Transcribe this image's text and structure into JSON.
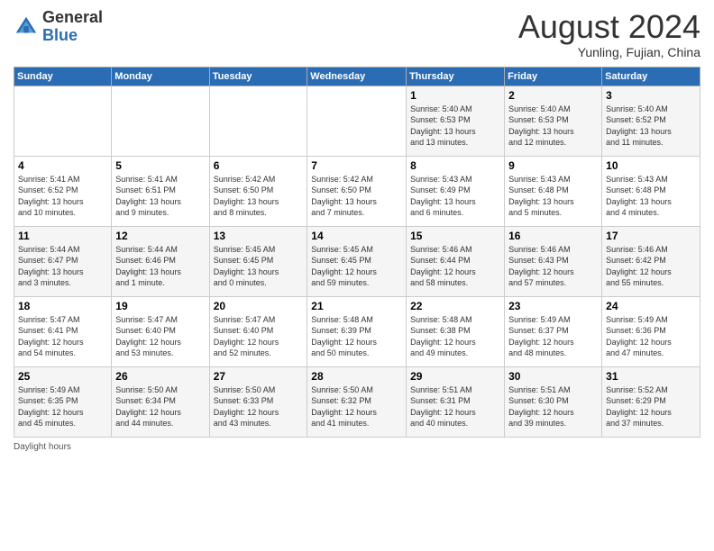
{
  "header": {
    "logo_general": "General",
    "logo_blue": "Blue",
    "month_title": "August 2024",
    "subtitle": "Yunling, Fujian, China"
  },
  "weekdays": [
    "Sunday",
    "Monday",
    "Tuesday",
    "Wednesday",
    "Thursday",
    "Friday",
    "Saturday"
  ],
  "footer": {
    "daylight_label": "Daylight hours"
  },
  "weeks": [
    [
      {
        "day": "",
        "info": ""
      },
      {
        "day": "",
        "info": ""
      },
      {
        "day": "",
        "info": ""
      },
      {
        "day": "",
        "info": ""
      },
      {
        "day": "1",
        "info": "Sunrise: 5:40 AM\nSunset: 6:53 PM\nDaylight: 13 hours\nand 13 minutes."
      },
      {
        "day": "2",
        "info": "Sunrise: 5:40 AM\nSunset: 6:53 PM\nDaylight: 13 hours\nand 12 minutes."
      },
      {
        "day": "3",
        "info": "Sunrise: 5:40 AM\nSunset: 6:52 PM\nDaylight: 13 hours\nand 11 minutes."
      }
    ],
    [
      {
        "day": "4",
        "info": "Sunrise: 5:41 AM\nSunset: 6:52 PM\nDaylight: 13 hours\nand 10 minutes."
      },
      {
        "day": "5",
        "info": "Sunrise: 5:41 AM\nSunset: 6:51 PM\nDaylight: 13 hours\nand 9 minutes."
      },
      {
        "day": "6",
        "info": "Sunrise: 5:42 AM\nSunset: 6:50 PM\nDaylight: 13 hours\nand 8 minutes."
      },
      {
        "day": "7",
        "info": "Sunrise: 5:42 AM\nSunset: 6:50 PM\nDaylight: 13 hours\nand 7 minutes."
      },
      {
        "day": "8",
        "info": "Sunrise: 5:43 AM\nSunset: 6:49 PM\nDaylight: 13 hours\nand 6 minutes."
      },
      {
        "day": "9",
        "info": "Sunrise: 5:43 AM\nSunset: 6:48 PM\nDaylight: 13 hours\nand 5 minutes."
      },
      {
        "day": "10",
        "info": "Sunrise: 5:43 AM\nSunset: 6:48 PM\nDaylight: 13 hours\nand 4 minutes."
      }
    ],
    [
      {
        "day": "11",
        "info": "Sunrise: 5:44 AM\nSunset: 6:47 PM\nDaylight: 13 hours\nand 3 minutes."
      },
      {
        "day": "12",
        "info": "Sunrise: 5:44 AM\nSunset: 6:46 PM\nDaylight: 13 hours\nand 1 minute."
      },
      {
        "day": "13",
        "info": "Sunrise: 5:45 AM\nSunset: 6:45 PM\nDaylight: 13 hours\nand 0 minutes."
      },
      {
        "day": "14",
        "info": "Sunrise: 5:45 AM\nSunset: 6:45 PM\nDaylight: 12 hours\nand 59 minutes."
      },
      {
        "day": "15",
        "info": "Sunrise: 5:46 AM\nSunset: 6:44 PM\nDaylight: 12 hours\nand 58 minutes."
      },
      {
        "day": "16",
        "info": "Sunrise: 5:46 AM\nSunset: 6:43 PM\nDaylight: 12 hours\nand 57 minutes."
      },
      {
        "day": "17",
        "info": "Sunrise: 5:46 AM\nSunset: 6:42 PM\nDaylight: 12 hours\nand 55 minutes."
      }
    ],
    [
      {
        "day": "18",
        "info": "Sunrise: 5:47 AM\nSunset: 6:41 PM\nDaylight: 12 hours\nand 54 minutes."
      },
      {
        "day": "19",
        "info": "Sunrise: 5:47 AM\nSunset: 6:40 PM\nDaylight: 12 hours\nand 53 minutes."
      },
      {
        "day": "20",
        "info": "Sunrise: 5:47 AM\nSunset: 6:40 PM\nDaylight: 12 hours\nand 52 minutes."
      },
      {
        "day": "21",
        "info": "Sunrise: 5:48 AM\nSunset: 6:39 PM\nDaylight: 12 hours\nand 50 minutes."
      },
      {
        "day": "22",
        "info": "Sunrise: 5:48 AM\nSunset: 6:38 PM\nDaylight: 12 hours\nand 49 minutes."
      },
      {
        "day": "23",
        "info": "Sunrise: 5:49 AM\nSunset: 6:37 PM\nDaylight: 12 hours\nand 48 minutes."
      },
      {
        "day": "24",
        "info": "Sunrise: 5:49 AM\nSunset: 6:36 PM\nDaylight: 12 hours\nand 47 minutes."
      }
    ],
    [
      {
        "day": "25",
        "info": "Sunrise: 5:49 AM\nSunset: 6:35 PM\nDaylight: 12 hours\nand 45 minutes."
      },
      {
        "day": "26",
        "info": "Sunrise: 5:50 AM\nSunset: 6:34 PM\nDaylight: 12 hours\nand 44 minutes."
      },
      {
        "day": "27",
        "info": "Sunrise: 5:50 AM\nSunset: 6:33 PM\nDaylight: 12 hours\nand 43 minutes."
      },
      {
        "day": "28",
        "info": "Sunrise: 5:50 AM\nSunset: 6:32 PM\nDaylight: 12 hours\nand 41 minutes."
      },
      {
        "day": "29",
        "info": "Sunrise: 5:51 AM\nSunset: 6:31 PM\nDaylight: 12 hours\nand 40 minutes."
      },
      {
        "day": "30",
        "info": "Sunrise: 5:51 AM\nSunset: 6:30 PM\nDaylight: 12 hours\nand 39 minutes."
      },
      {
        "day": "31",
        "info": "Sunrise: 5:52 AM\nSunset: 6:29 PM\nDaylight: 12 hours\nand 37 minutes."
      }
    ]
  ]
}
